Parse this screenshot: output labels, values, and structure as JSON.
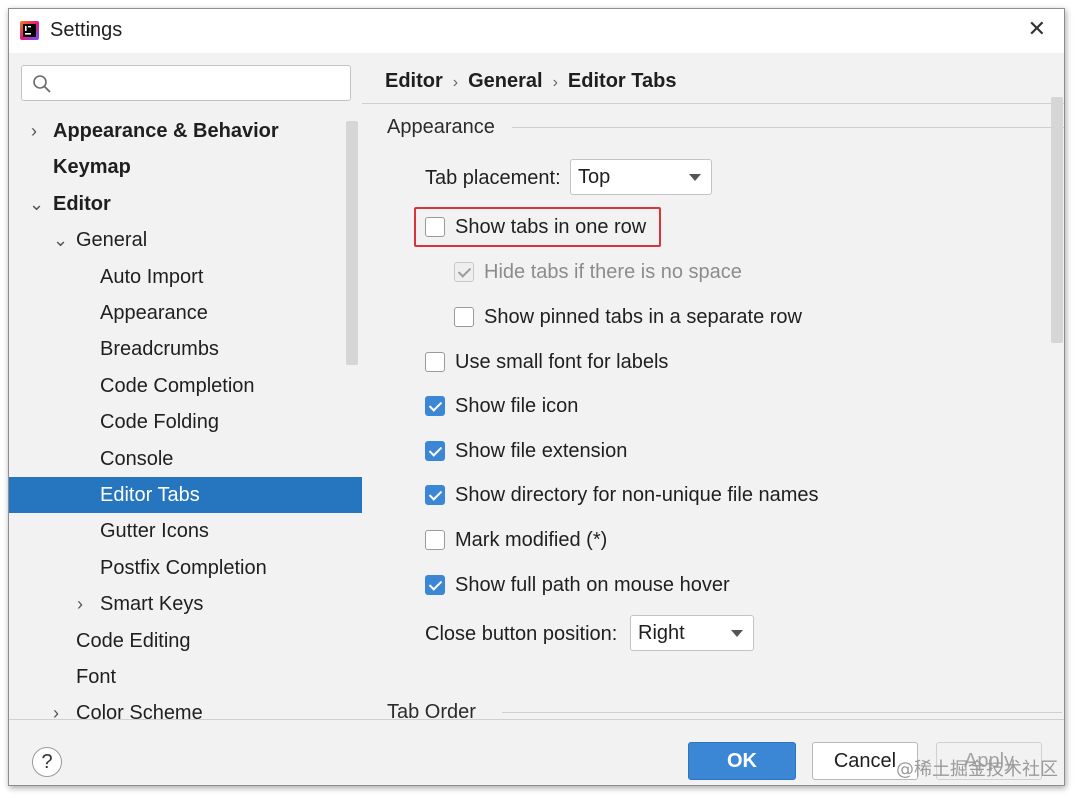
{
  "window": {
    "title": "Settings",
    "close_glyph": "✕"
  },
  "search": {
    "placeholder": "",
    "value": ""
  },
  "tree": [
    {
      "label": "Appearance & Behavior",
      "chevron": "›",
      "bold": true
    },
    {
      "label": "Keymap",
      "chevron": "",
      "bold": true
    },
    {
      "label": "Editor",
      "chevron": "⌄",
      "bold": true
    },
    {
      "label": "General",
      "chevron": "⌄"
    },
    {
      "label": "Auto Import"
    },
    {
      "label": "Appearance"
    },
    {
      "label": "Breadcrumbs"
    },
    {
      "label": "Code Completion"
    },
    {
      "label": "Code Folding"
    },
    {
      "label": "Console"
    },
    {
      "label": "Editor Tabs",
      "selected": true
    },
    {
      "label": "Gutter Icons"
    },
    {
      "label": "Postfix Completion"
    },
    {
      "label": "Smart Keys",
      "chevron": "›"
    },
    {
      "label": "Code Editing"
    },
    {
      "label": "Font"
    },
    {
      "label": "Color Scheme",
      "chevron": "›"
    }
  ],
  "breadcrumb": {
    "items": [
      "Editor",
      "General",
      "Editor Tabs"
    ],
    "separator": "›"
  },
  "appearance": {
    "section_title": "Appearance",
    "tab_placement_label": "Tab placement:",
    "tab_placement_value": "Top",
    "options": [
      {
        "label": "Show tabs in one row",
        "checked": false,
        "highlighted": true
      },
      {
        "label": "Hide tabs if there is no space",
        "checked": true,
        "disabled": true
      },
      {
        "label": "Show pinned tabs in a separate row",
        "checked": false
      },
      {
        "label": "Use small font for labels",
        "checked": false
      },
      {
        "label": "Show file icon",
        "checked": true
      },
      {
        "label": "Show file extension",
        "checked": true
      },
      {
        "label": "Show directory for non-unique file names",
        "checked": true
      },
      {
        "label": "Mark modified (*)",
        "checked": false
      },
      {
        "label": "Show full path on mouse hover",
        "checked": true
      }
    ],
    "close_button_label": "Close button position:",
    "close_button_value": "Right"
  },
  "tab_order": {
    "section_title": "Tab Order"
  },
  "footer": {
    "help": "?",
    "ok": "OK",
    "cancel": "Cancel",
    "apply": "Apply"
  },
  "watermark": "@稀土掘金技术社区",
  "colors": {
    "accent": "#3c86d6",
    "selection": "#2675bf",
    "highlight_border": "#d9343e"
  }
}
